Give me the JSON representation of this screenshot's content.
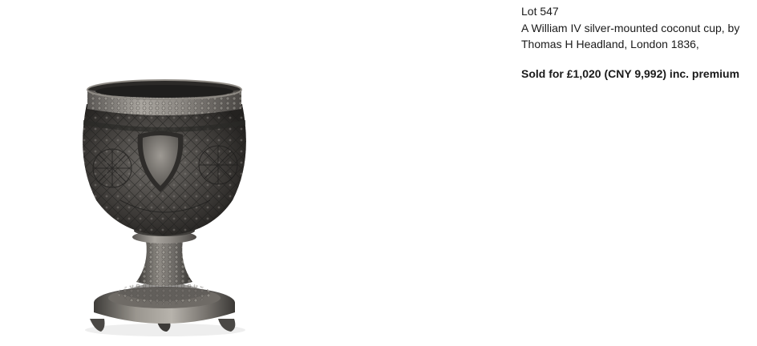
{
  "lot": {
    "number_label": "Lot 547",
    "description": "A William IV silver-mounted coconut cup, by Thomas H Headland, London 1836,",
    "sold_text": "Sold for £1,020 (CNY 9,992) inc. premium"
  },
  "image": {
    "subject": "silver-mounted coconut cup",
    "colors": {
      "background": "#ffffff",
      "metal_dark": "#3a3836",
      "metal_mid": "#6b6864",
      "metal_light": "#a8a49e"
    }
  }
}
